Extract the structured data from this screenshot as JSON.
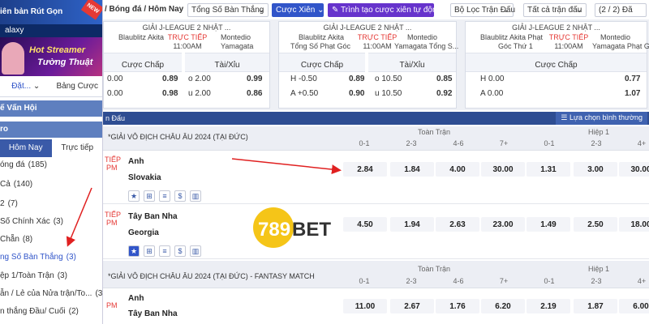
{
  "sidebar": {
    "banner_text": "iên bản Rút Gọn",
    "new_badge": "NEW",
    "galaxy": "alaxy",
    "promo_line1": "Hot Streamer",
    "promo_line2": "Tường Thuật",
    "tab_left": "Đặt...",
    "tab_left_chevron": "⌄",
    "tab_right": "Bảng Cược",
    "category1": "ế Vấn Hội",
    "category2": "ro",
    "tab_today": "Hôm Nay",
    "tab_live": "Trực tiếp",
    "items": [
      {
        "label": "óng đá",
        "count": "(185)"
      },
      {
        "label": "Cả",
        "count": "(140)"
      },
      {
        "label": "2",
        "count": "(7)"
      },
      {
        "label": "Số Chính Xác",
        "count": "(3)"
      },
      {
        "label": "Chẵn",
        "count": "(8)"
      },
      {
        "label": "ng Số Bàn Thắng",
        "count": "(3)"
      },
      {
        "label": "ệp 1/Toàn Trận",
        "count": "(3)"
      },
      {
        "label": "ẫn / Lẻ của Nửa trận/To...",
        "count": "(3)"
      },
      {
        "label": "n thắng Đầu/ Cuối",
        "count": "(2)"
      }
    ]
  },
  "topbar": {
    "breadcrumb": "/ Bóng đá / Hôm Nay",
    "market_select": "Tổng Số Bàn Thắng",
    "parlay_button": "Cược Xiên",
    "auto_parlay_button": "Trình tạo cược xiên tự động",
    "filter_select": "Bộ Lọc Trận Đấu",
    "all_matches_select": "Tất cả trận đấu",
    "page_indicator": "(2 / 2) Đã"
  },
  "cards": [
    {
      "league": "GIẢI J-LEAGUE 2 NHẬT ...",
      "home": "Blaublitz Akita",
      "home2": "",
      "live": "TRỰC TIẾP",
      "time": "11:00AM",
      "away": "Montedio",
      "away2": "Yamagata",
      "col1": "Cược Chấp",
      "col2": "Tài/Xỉu",
      "rows": [
        {
          "a_lbl": "0.00",
          "a_val": "0.89",
          "b_lbl": "o 2.00",
          "b_val": "0.99"
        },
        {
          "a_lbl": "0.00",
          "a_val": "0.98",
          "b_lbl": "u 2.00",
          "b_val": "0.86"
        }
      ]
    },
    {
      "league": "GIẢI J-LEAGUE 2 NHẬT ...",
      "home": "Blaublitz Akita",
      "home2": "Tổng Số Phạt Góc",
      "live": "TRỰC TIẾP",
      "time": "11:00AM",
      "away": "Montedio",
      "away2": "Yamagata Tổng S...",
      "col1": "Cược Chấp",
      "col2": "Tài/Xỉu",
      "rows": [
        {
          "a_lbl": "H -0.50",
          "a_val": "0.89",
          "b_lbl": "o 10.50",
          "b_val": "0.85"
        },
        {
          "a_lbl": "A +0.50",
          "a_val": "0.90",
          "b_lbl": "u 10.50",
          "b_val": "0.92"
        }
      ]
    },
    {
      "league": "GIẢI J-LEAGUE 2 NHẬT ...",
      "home": "Blaublitz Akita Phạt",
      "home2": "Góc Thứ 1",
      "live": "TRỰC TIẾP",
      "time": "11:00AM",
      "away": "Montedio",
      "away2": "Yamagata Phạt G...",
      "col1": "Cược Chấp",
      "rows": [
        {
          "a_lbl": "H 0.00",
          "a_val": "0.77"
        },
        {
          "a_lbl": "A 0.00",
          "a_val": "1.07"
        }
      ]
    }
  ],
  "table": {
    "header_label": "n Đấu",
    "options_button": "Lựa chọn bình thường",
    "group_full": "Toàn Trận",
    "group_half": "Hiệp 1",
    "cols_full": [
      "0-1",
      "2-3",
      "4-6",
      "7+"
    ],
    "cols_half": [
      "0-1",
      "2-3",
      "4+"
    ],
    "competitions": [
      {
        "name": "*GIẢI VÔ ĐỊCH CHÂU ÂU 2024 (TẠI ĐỨC)",
        "matches": [
          {
            "live": "TIẾP",
            "time": "PM",
            "home": "Anh",
            "away": "Slovakia",
            "full": [
              "2.84",
              "1.84",
              "4.00",
              "30.00"
            ],
            "half": [
              "1.31",
              "3.00",
              "30.00"
            ]
          },
          {
            "live": "TIẾP",
            "time": "PM",
            "home": "Tây Ban Nha",
            "away": "Georgia",
            "full": [
              "4.50",
              "1.94",
              "2.63",
              "23.00"
            ],
            "half": [
              "1.49",
              "2.50",
              "18.00"
            ]
          }
        ]
      },
      {
        "name": "*GIẢI VÔ ĐỊCH CHÂU ÂU 2024 (TẠI ĐỨC) - FANTASY MATCH",
        "matches": [
          {
            "live": "",
            "time": "PM",
            "home": "Anh",
            "away": "Tây Ban Nha",
            "full": [
              "11.00",
              "2.67",
              "1.76",
              "6.20"
            ],
            "half": [
              "2.19",
              "1.87",
              "6.00"
            ]
          }
        ]
      }
    ]
  },
  "logo": {
    "num": "789",
    "bet": "BET"
  },
  "colors": {
    "accent": "#3155c9",
    "live": "#e53935",
    "header": "#2e4d92",
    "annotation_arrow": "#e02020"
  }
}
